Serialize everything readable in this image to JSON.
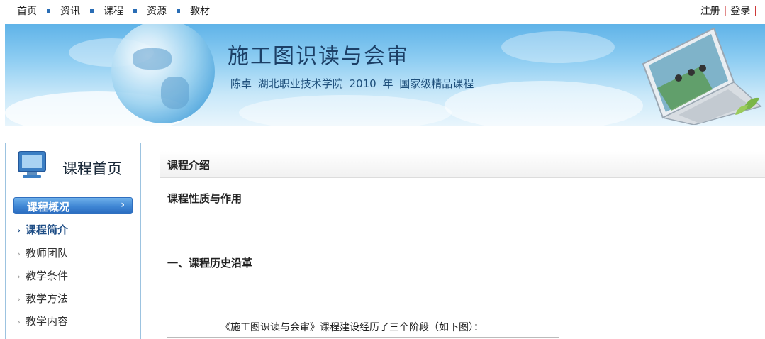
{
  "topnav": {
    "items": [
      "首页",
      "资讯",
      "课程",
      "资源",
      "教材"
    ],
    "register": "注册",
    "login": "登录"
  },
  "banner": {
    "title": "施工图识读与会审",
    "subtitle": "陈卓   湖北职业技术学院   2010 年   国家级精品课程"
  },
  "sidebar": {
    "title": "课程首页",
    "active_section": "课程概况",
    "items": [
      {
        "label": "课程简介",
        "current": true
      },
      {
        "label": "教师团队",
        "current": false
      },
      {
        "label": "教学条件",
        "current": false
      },
      {
        "label": "教学方法",
        "current": false
      },
      {
        "label": "教学内容",
        "current": false
      }
    ]
  },
  "main": {
    "header": "课程介绍",
    "section1": "课程性质与作用",
    "section2": "一、课程历史沿革",
    "paragraph": "《施工图识读与会审》课程建设经历了三个阶段（如下图）："
  },
  "colors": {
    "accent": "#3f86d4",
    "nav_separator": "#2a6db5",
    "auth_separator": "#cc3333",
    "banner_text": "#1c3f66"
  }
}
